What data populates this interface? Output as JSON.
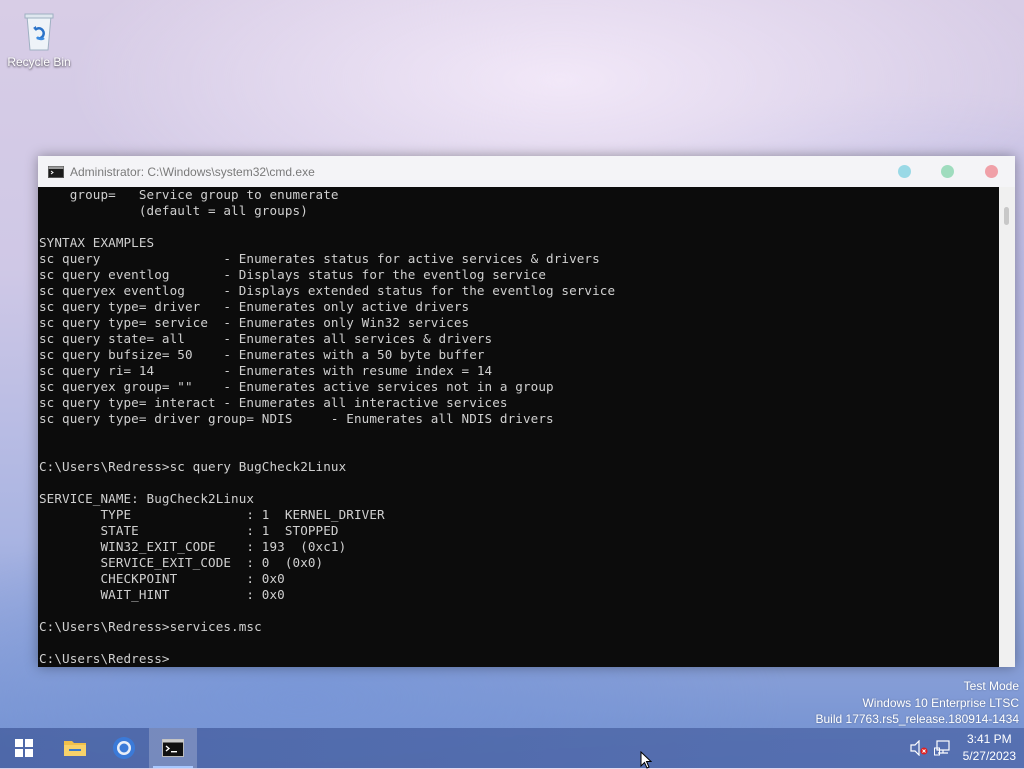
{
  "desktop": {
    "recycle_bin_label": "Recycle Bin"
  },
  "window": {
    "title": "Administrator: C:\\Windows\\system32\\cmd.exe",
    "control_colors": [
      "#9ad9e6",
      "#9fdcbe",
      "#f0a0a8"
    ]
  },
  "console": {
    "lines": [
      "    group=   Service group to enumerate",
      "             (default = all groups)",
      "",
      "SYNTAX EXAMPLES",
      "sc query                - Enumerates status for active services & drivers",
      "sc query eventlog       - Displays status for the eventlog service",
      "sc queryex eventlog     - Displays extended status for the eventlog service",
      "sc query type= driver   - Enumerates only active drivers",
      "sc query type= service  - Enumerates only Win32 services",
      "sc query state= all     - Enumerates all services & drivers",
      "sc query bufsize= 50    - Enumerates with a 50 byte buffer",
      "sc query ri= 14         - Enumerates with resume index = 14",
      "sc queryex group= \"\"    - Enumerates active services not in a group",
      "sc query type= interact - Enumerates all interactive services",
      "sc query type= driver group= NDIS     - Enumerates all NDIS drivers",
      "",
      "",
      "C:\\Users\\Redress>sc query BugCheck2Linux",
      "",
      "SERVICE_NAME: BugCheck2Linux",
      "        TYPE               : 1  KERNEL_DRIVER",
      "        STATE              : 1  STOPPED",
      "        WIN32_EXIT_CODE    : 193  (0xc1)",
      "        SERVICE_EXIT_CODE  : 0  (0x0)",
      "        CHECKPOINT         : 0x0",
      "        WAIT_HINT          : 0x0",
      "",
      "C:\\Users\\Redress>services.msc",
      "",
      "C:\\Users\\Redress>"
    ]
  },
  "watermark": {
    "line1": "Test Mode",
    "line2": "Windows 10 Enterprise LTSC",
    "line3": "Build 17763.rs5_release.180914-1434"
  },
  "taskbar": {
    "items": [
      {
        "name": "start",
        "icon": "windows-logo-icon"
      },
      {
        "name": "file-explorer",
        "icon": "folder-icon"
      },
      {
        "name": "chrome",
        "icon": "chrome-icon"
      },
      {
        "name": "cmd",
        "icon": "cmd-icon",
        "active": true
      }
    ],
    "tray": {
      "volume_icon": "volume-muted-icon",
      "network_icon": "network-icon"
    },
    "clock": {
      "time": "3:41 PM",
      "date": "5/27/2023"
    }
  }
}
